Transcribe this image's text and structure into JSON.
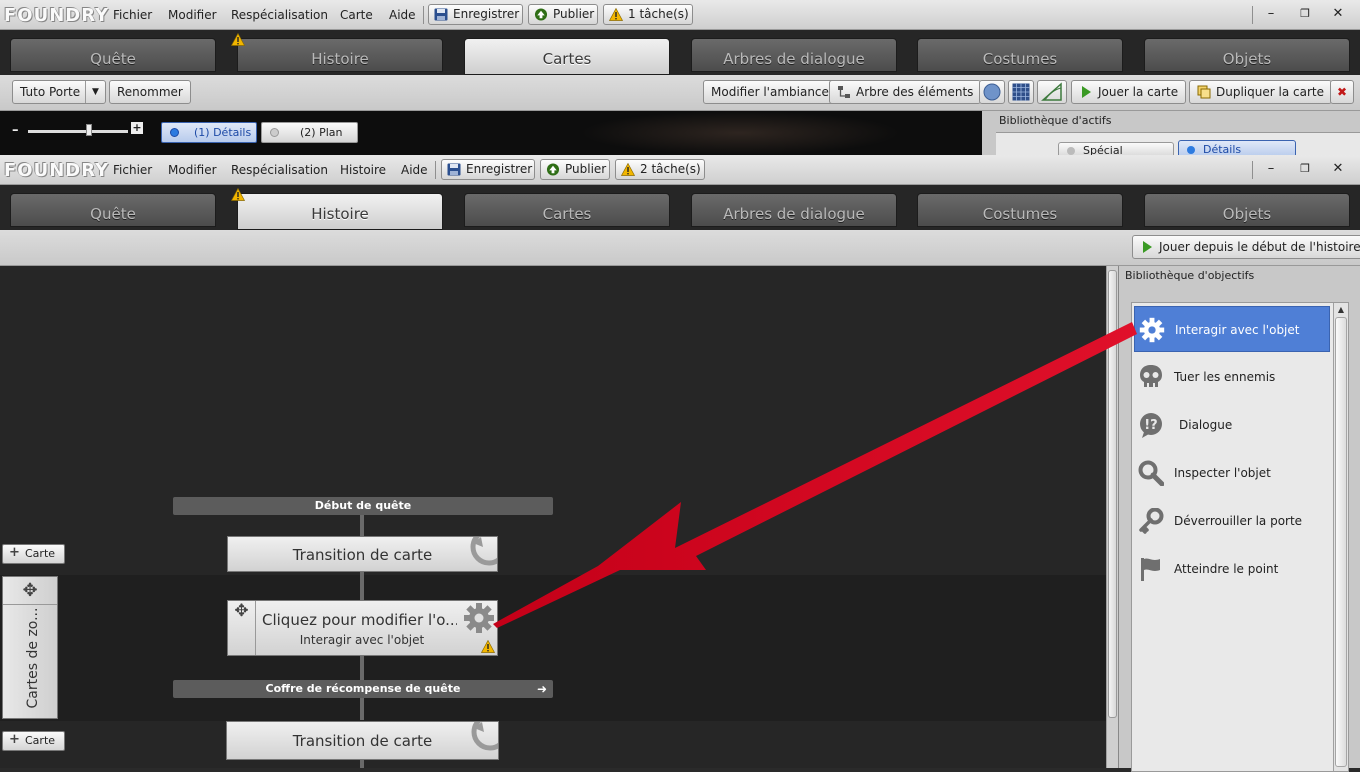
{
  "app": {
    "logo": "FOUNDRY"
  },
  "back_window": {
    "menu": [
      "Fichier",
      "Modifier",
      "Respécialisation",
      "Carte",
      "Aide"
    ],
    "toolbar": {
      "save": "Enregistrer",
      "publish": "Publier",
      "tasks": "1 tâche(s)"
    },
    "tabs": [
      "Quête",
      "Histoire",
      "Cartes",
      "Arbres de dialogue",
      "Costumes",
      "Objets"
    ],
    "active_tab": "Cartes",
    "subtoolbar": {
      "map_select": "Tuto Porte",
      "rename": "Renommer",
      "ambiance": "Modifier l'ambiance",
      "element_tree": "Arbre des éléments",
      "play_map": "Jouer la carte",
      "duplicate_map": "Dupliquer la carte"
    },
    "view_toggle": {
      "details": "(1) Détails",
      "plan": "(2) Plan"
    },
    "asset_library": {
      "title": "Bibliothèque d'actifs",
      "tabs": [
        "Spécial",
        "Détails"
      ]
    }
  },
  "front_window": {
    "menu": [
      "Fichier",
      "Modifier",
      "Respécialisation",
      "Histoire",
      "Aide"
    ],
    "toolbar": {
      "save": "Enregistrer",
      "publish": "Publier",
      "tasks": "2 tâche(s)"
    },
    "tabs": [
      "Quête",
      "Histoire",
      "Cartes",
      "Arbres de dialogue",
      "Costumes",
      "Objets"
    ],
    "active_tab": "Histoire",
    "play_from_start": "Jouer depuis le début de l'histoire"
  },
  "story": {
    "quest_start": "Début de quête",
    "transition_1": "Transition de carte",
    "objective_title": "Cliquez pour modifier l'o...",
    "objective_subtitle": "Interagir avec l'objet",
    "reward_chest": "Coffre de récompense de quête",
    "transition_2": "Transition de carte",
    "add_map_1": "Carte",
    "add_map_2": "Carte",
    "zone_maps": "Cartes de zo..."
  },
  "objective_library": {
    "title": "Bibliothèque d'objectifs",
    "items": [
      {
        "label": "Interagir avec l'objet",
        "icon": "gear-icon",
        "selected": true
      },
      {
        "label": "Tuer les ennemis",
        "icon": "skull-icon",
        "selected": false
      },
      {
        "label": "Dialogue",
        "icon": "dialogue-icon",
        "selected": false
      },
      {
        "label": "Inspecter l'objet",
        "icon": "magnifier-icon",
        "selected": false
      },
      {
        "label": "Déverrouiller la porte",
        "icon": "key-icon",
        "selected": false
      },
      {
        "label": "Atteindre le point",
        "icon": "flag-icon",
        "selected": false
      }
    ]
  },
  "colors": {
    "selection": "#4f7fd6",
    "annotation_arrow": "#d0001c",
    "warning": "#f2b600"
  }
}
